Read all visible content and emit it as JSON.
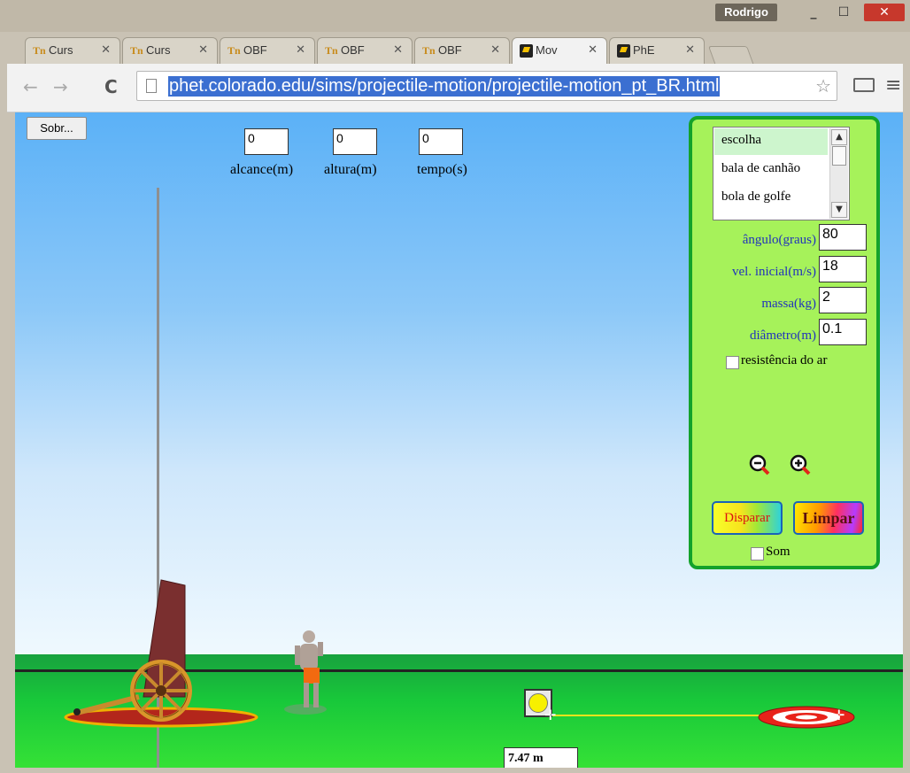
{
  "window": {
    "profile_name": "Rodrigo",
    "minimize": "_",
    "maximize": "☐",
    "close": "✕"
  },
  "tabs": [
    {
      "label": "Curs",
      "favicon": "tn-icon"
    },
    {
      "label": "Curs",
      "favicon": "tn-icon"
    },
    {
      "label": "OBF",
      "favicon": "tn-icon"
    },
    {
      "label": "OBF",
      "favicon": "tn-icon"
    },
    {
      "label": "OBF",
      "favicon": "tn-icon"
    },
    {
      "label": "Mov",
      "favicon": "phet-icon",
      "active": true
    },
    {
      "label": "PhE",
      "favicon": "phet-icon"
    }
  ],
  "toolbar": {
    "back": "←",
    "forward": "→",
    "reload": "C",
    "url": "phet.colorado.edu/sims/projectile-motion/projectile-motion_pt_BR.html",
    "star": "☆",
    "menu": "≡"
  },
  "sim": {
    "about_button": "Sobr...",
    "readouts": [
      {
        "label": "alcance(m)",
        "value": "0"
      },
      {
        "label": "altura(m)",
        "value": "0"
      },
      {
        "label": "tempo(s)",
        "value": "0"
      }
    ],
    "projectile_list": {
      "items": [
        "escolha",
        "bala de canhão",
        "bola de golfe"
      ],
      "selected_index": 0
    },
    "params": [
      {
        "label": "ângulo(graus)",
        "value": "80"
      },
      {
        "label": "vel. inicial(m/s)",
        "value": "18"
      },
      {
        "label": "massa(kg)",
        "value": "2"
      },
      {
        "label": "diâmetro(m)",
        "value": "0.1"
      }
    ],
    "air_resistance_label": "resistência do ar",
    "air_resistance_checked": false,
    "fire_button": "Disparar",
    "clear_button": "Limpar",
    "sound_label": "Som",
    "sound_checked": false,
    "tape_measure_readout": "7.47 m"
  },
  "colors": {
    "panel_bg": "#a6f25a",
    "panel_border": "#13a22b",
    "url_highlight": "#3b6fd1",
    "param_label": "#2233bb"
  }
}
